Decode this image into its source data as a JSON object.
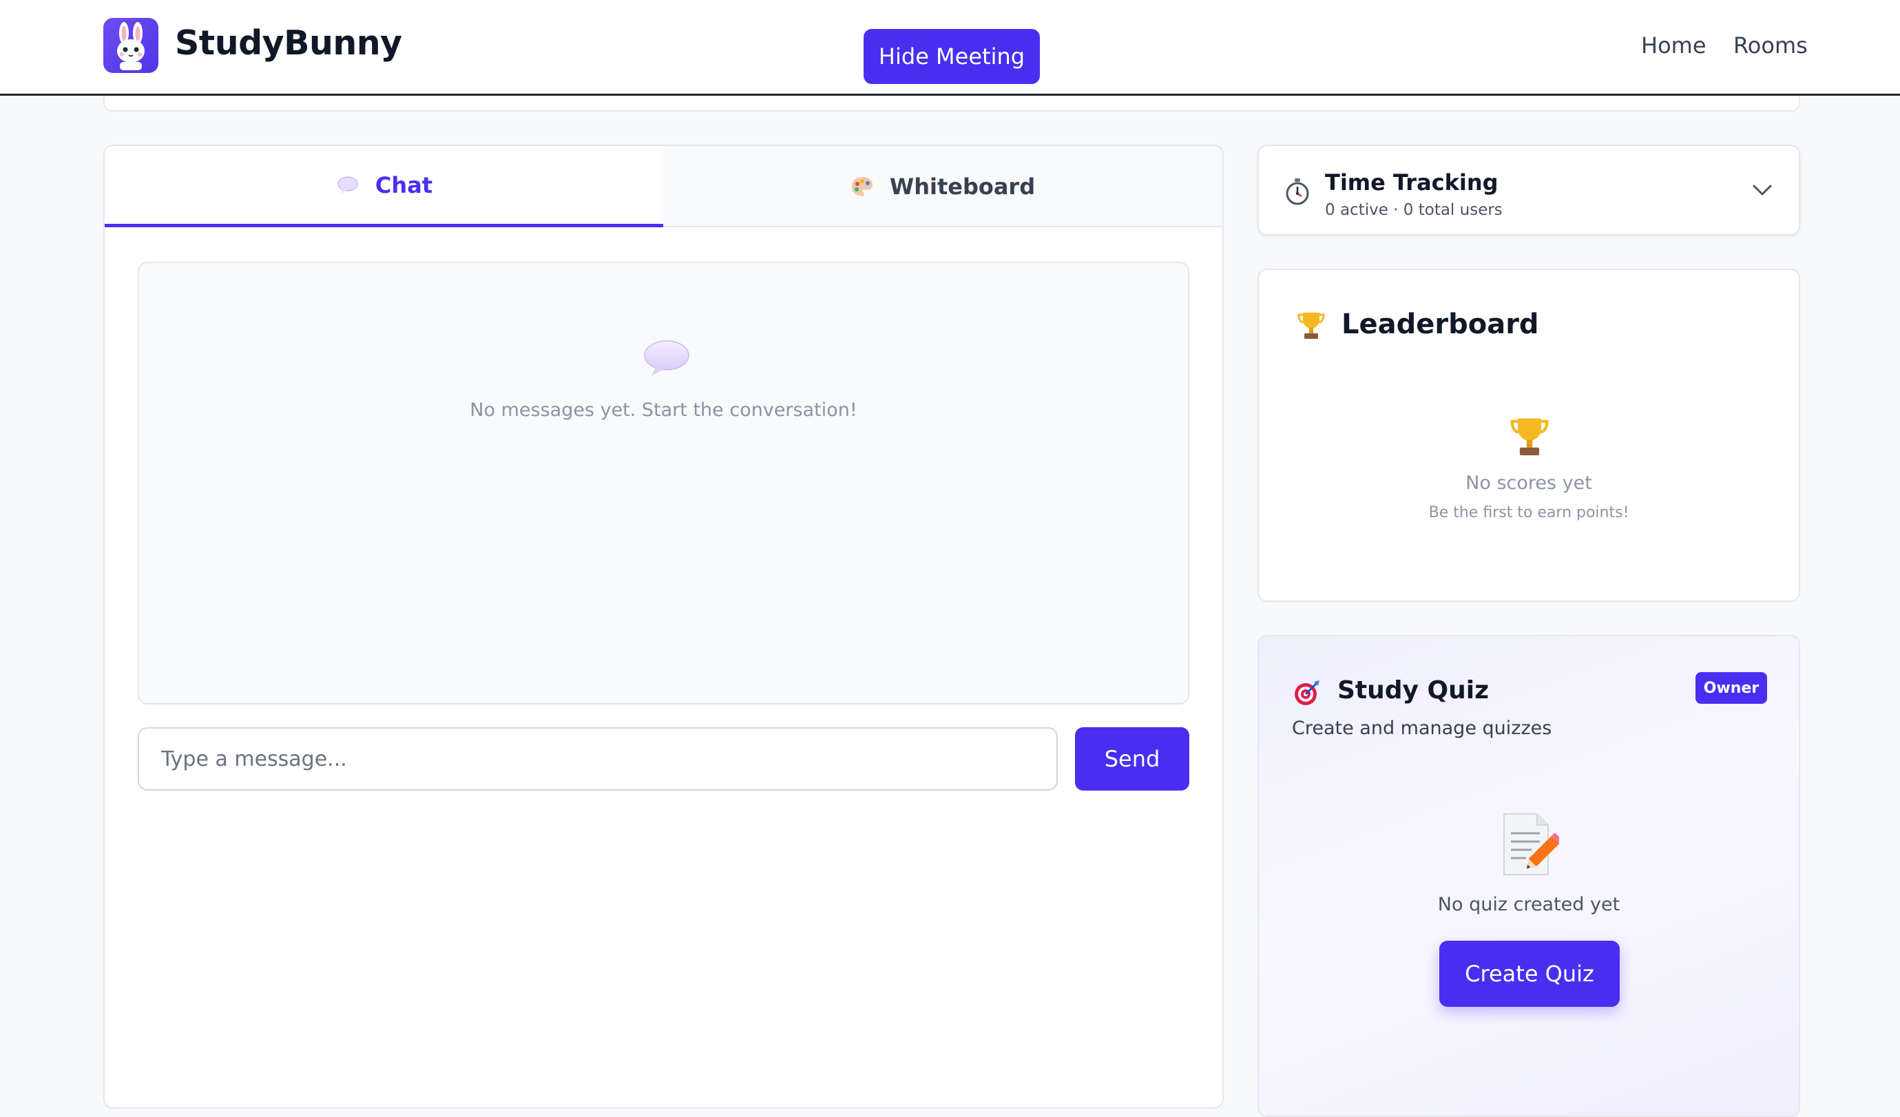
{
  "header": {
    "brand": "StudyBunny",
    "hide_meeting_label": "Hide Meeting",
    "nav": {
      "home": "Home",
      "rooms": "Rooms"
    }
  },
  "tabs": {
    "chat": "Chat",
    "whiteboard": "Whiteboard"
  },
  "chat": {
    "empty_text": "No messages yet. Start the conversation!",
    "input_placeholder": "Type a message...",
    "send_label": "Send"
  },
  "time_tracking": {
    "title": "Time Tracking",
    "subtitle": "0 active · 0 total users"
  },
  "leaderboard": {
    "title": "Leaderboard",
    "empty_title": "No scores yet",
    "empty_sub": "Be the first to earn points!"
  },
  "quiz": {
    "title": "Study Quiz",
    "badge": "Owner",
    "subtitle": "Create and manage quizzes",
    "empty_text": "No quiz created yet",
    "create_label": "Create Quiz"
  },
  "colors": {
    "accent": "#4a2ef0",
    "border": "#e5e7eb",
    "muted_text": "#8a94a6"
  },
  "icons": {
    "logo": "bunny-logo-icon",
    "chat_tab": "speech-bubble-icon",
    "whiteboard_tab": "palette-icon",
    "time": "stopwatch-icon",
    "trophy": "trophy-icon",
    "quiz": "target-icon",
    "doc": "document-pencil-icon",
    "chevron": "chevron-down-icon"
  }
}
